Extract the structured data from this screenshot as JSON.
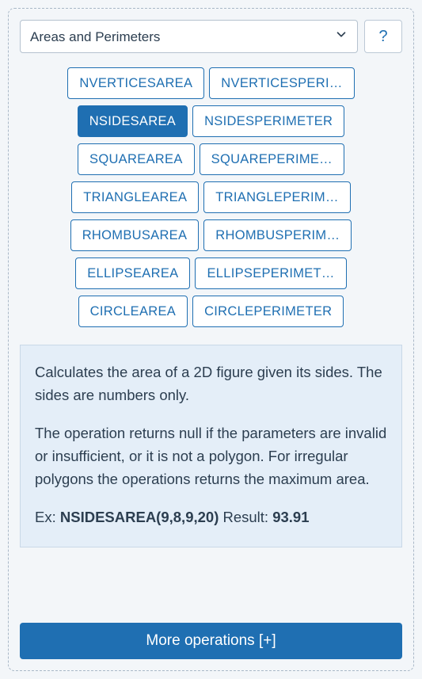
{
  "category": {
    "selected": "Areas and Perimeters"
  },
  "help_label": "?",
  "operations": [
    {
      "label": "NVERTICESAREA",
      "selected": false
    },
    {
      "label": "NVERTICESPERI…",
      "selected": false
    },
    {
      "label": "NSIDESAREA",
      "selected": true
    },
    {
      "label": "NSIDESPERIMETER",
      "selected": false
    },
    {
      "label": "SQUAREAREA",
      "selected": false
    },
    {
      "label": "SQUAREPERIME…",
      "selected": false
    },
    {
      "label": "TRIANGLEAREA",
      "selected": false
    },
    {
      "label": "TRIANGLEPERIM…",
      "selected": false
    },
    {
      "label": "RHOMBUSAREA",
      "selected": false
    },
    {
      "label": "RHOMBUSPERIM…",
      "selected": false
    },
    {
      "label": "ELLIPSEAREA",
      "selected": false
    },
    {
      "label": "ELLIPSEPERIMET…",
      "selected": false
    },
    {
      "label": "CIRCLEAREA",
      "selected": false
    },
    {
      "label": "CIRCLEPERIMETER",
      "selected": false
    }
  ],
  "description": {
    "p1": "Calculates the area of a 2D figure given its sides. The sides are numbers only.",
    "p2": "The operation returns null if the parameters are invalid or insufficient, or it is not a polygon. For irregular polygons the operations returns the maximum area.",
    "ex_prefix": "Ex: ",
    "ex_call": "NSIDESAREA(9,8,9,20)",
    "ex_result_prefix": " Result: ",
    "ex_result_value": "93.91"
  },
  "more_label": "More operations [+]"
}
